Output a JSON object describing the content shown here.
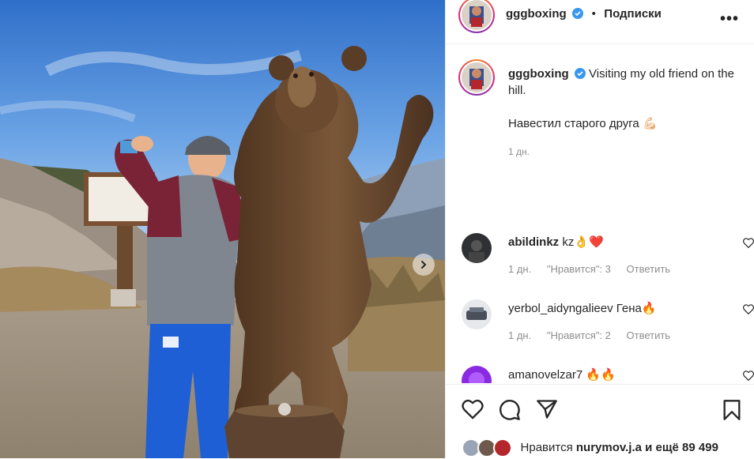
{
  "post": {
    "author": "gggboxing",
    "follow_label": "Подписки",
    "separator": "•",
    "more_label": "•••"
  },
  "caption": {
    "author": "gggboxing",
    "text": "Visiting my old friend on the hill.",
    "text_ru": "Навестил старого друга 💪🏻",
    "time": "1 дн."
  },
  "comments": [
    {
      "username": "abildinkz",
      "text": "kz👌❤️",
      "time": "1 дн.",
      "likes": "\"Нравится\": 3",
      "reply": "Ответить"
    },
    {
      "username": "yerbol_aidyngalieev",
      "text": "Гена🔥",
      "time": "1 дн.",
      "likes": "\"Нравится\": 2",
      "reply": "Ответить"
    },
    {
      "username": "amanovelzar7",
      "text": "🔥🔥"
    }
  ],
  "likes": {
    "prefix": "Нравится",
    "user": "nurymov.j.a",
    "suffix": "и ещё 89 499"
  },
  "icons": [
    "verified-icon",
    "more-icon",
    "heart-icon",
    "comment-icon",
    "share-icon",
    "bookmark-icon",
    "chevron-right-icon"
  ],
  "colors": {
    "verified": "#3897f0",
    "sky": "#4a86d4",
    "bear": "#6b4a30",
    "jacket": "#7a2336",
    "pants": "#1f5fd6"
  }
}
